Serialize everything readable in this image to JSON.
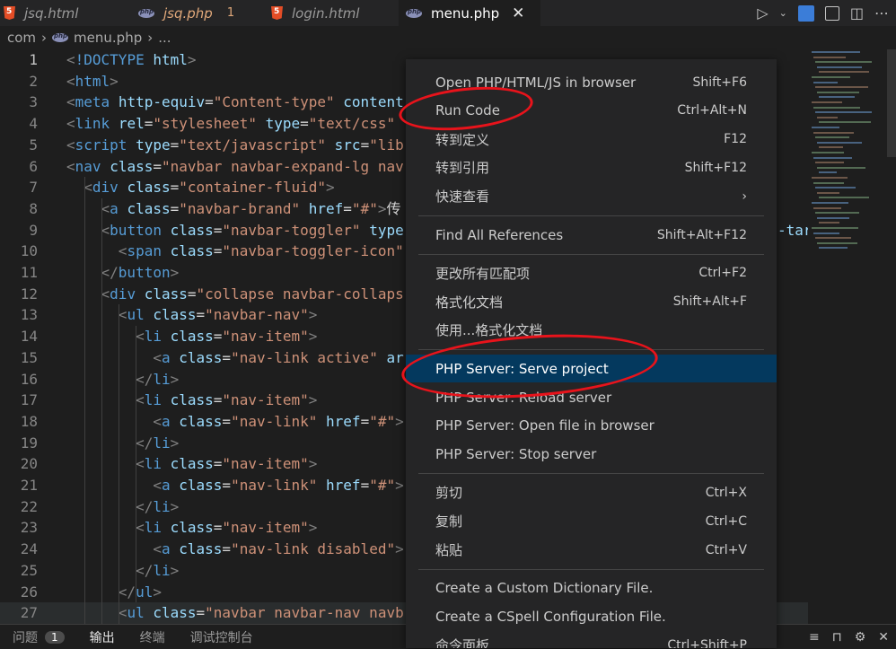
{
  "tabs": [
    {
      "name": "jsq.html",
      "icon": "html5-icon",
      "active": false
    },
    {
      "name": "jsq.php",
      "icon": "php-icon",
      "active": false,
      "count": "1"
    },
    {
      "name": "login.html",
      "icon": "html5-icon",
      "active": false
    },
    {
      "name": "menu.php",
      "icon": "php-icon",
      "active": true,
      "close": "✕"
    }
  ],
  "breadcrumb": [
    "com",
    "›",
    "menu.php",
    "›",
    "..."
  ],
  "code_lines": [
    {
      "n": "1",
      "t": "<!DOCTYPE html>"
    },
    {
      "n": "2",
      "t": "<html>"
    },
    {
      "n": "3",
      "t": "<meta http-equiv=\"Content-type\" content"
    },
    {
      "n": "4",
      "t": "<link rel=\"stylesheet\" type=\"text/css\" "
    },
    {
      "n": "5",
      "t": "<script type=\"text/javascript\" src=\"lib"
    },
    {
      "n": "6",
      "t": "<nav class=\"navbar navbar-expand-lg nav"
    },
    {
      "n": "7",
      "t": "  <div class=\"container-fluid\">"
    },
    {
      "n": "8",
      "t": "    <a class=\"navbar-brand\" href=\"#\">传"
    },
    {
      "n": "9",
      "t": "    <button class=\"navbar-toggler\" type"
    },
    {
      "n": "10",
      "t": "      <span class=\"navbar-toggler-icon\""
    },
    {
      "n": "11",
      "t": "    </button>"
    },
    {
      "n": "12",
      "t": "    <div class=\"collapse navbar-collaps"
    },
    {
      "n": "13",
      "t": "      <ul class=\"navbar-nav\">"
    },
    {
      "n": "14",
      "t": "        <li class=\"nav-item\">"
    },
    {
      "n": "15",
      "t": "          <a class=\"nav-link active\" ar"
    },
    {
      "n": "16",
      "t": "        </li>"
    },
    {
      "n": "17",
      "t": "        <li class=\"nav-item\">"
    },
    {
      "n": "18",
      "t": "          <a class=\"nav-link\" href=\"#\">"
    },
    {
      "n": "19",
      "t": "        </li>"
    },
    {
      "n": "20",
      "t": "        <li class=\"nav-item\">"
    },
    {
      "n": "21",
      "t": "          <a class=\"nav-link\" href=\"#\">"
    },
    {
      "n": "22",
      "t": "        </li>"
    },
    {
      "n": "23",
      "t": "        <li class=\"nav-item\">"
    },
    {
      "n": "24",
      "t": "          <a class=\"nav-link disabled\">"
    },
    {
      "n": "25",
      "t": "        </li>"
    },
    {
      "n": "26",
      "t": "      </ul>"
    },
    {
      "n": "27",
      "t": "      <ul class=\"navbar navbar-nav navb"
    }
  ],
  "overflow_text": "-tar",
  "context_menu": [
    {
      "label": "Open PHP/HTML/JS in browser",
      "key": "Shift+F6"
    },
    {
      "label": "Run Code",
      "key": "Ctrl+Alt+N"
    },
    {
      "label": "转到定义",
      "key": "F12"
    },
    {
      "label": "转到引用",
      "key": "Shift+F12"
    },
    {
      "label": "快速查看",
      "key": "›"
    },
    {
      "sep": true
    },
    {
      "label": "Find All References",
      "key": "Shift+Alt+F12"
    },
    {
      "sep": true
    },
    {
      "label": "更改所有匹配项",
      "key": "Ctrl+F2"
    },
    {
      "label": "格式化文档",
      "key": "Shift+Alt+F"
    },
    {
      "label": "使用...格式化文档",
      "key": ""
    },
    {
      "sep": true
    },
    {
      "label": "PHP Server: Serve project",
      "key": "",
      "selected": true
    },
    {
      "label": "PHP Server: Reload server",
      "key": ""
    },
    {
      "label": "PHP Server: Open file in browser",
      "key": ""
    },
    {
      "label": "PHP Server: Stop server",
      "key": ""
    },
    {
      "sep": true
    },
    {
      "label": "剪切",
      "key": "Ctrl+X"
    },
    {
      "label": "复制",
      "key": "Ctrl+C"
    },
    {
      "label": "粘贴",
      "key": "Ctrl+V"
    },
    {
      "sep": true
    },
    {
      "label": "Create a Custom Dictionary File.",
      "key": ""
    },
    {
      "label": "Create a CSpell Configuration File.",
      "key": ""
    },
    {
      "label": "命令面板...",
      "key": "Ctrl+Shift+P"
    }
  ],
  "panel": {
    "tabs": [
      "问题",
      "输出",
      "终端",
      "调试控制台"
    ],
    "problems_count": "1",
    "active": "输出"
  },
  "colors": {
    "selection": "#04395e",
    "annotation": "#e8131b",
    "tag": "#569cd6",
    "attr": "#9cdcfe",
    "string": "#ce9178"
  }
}
